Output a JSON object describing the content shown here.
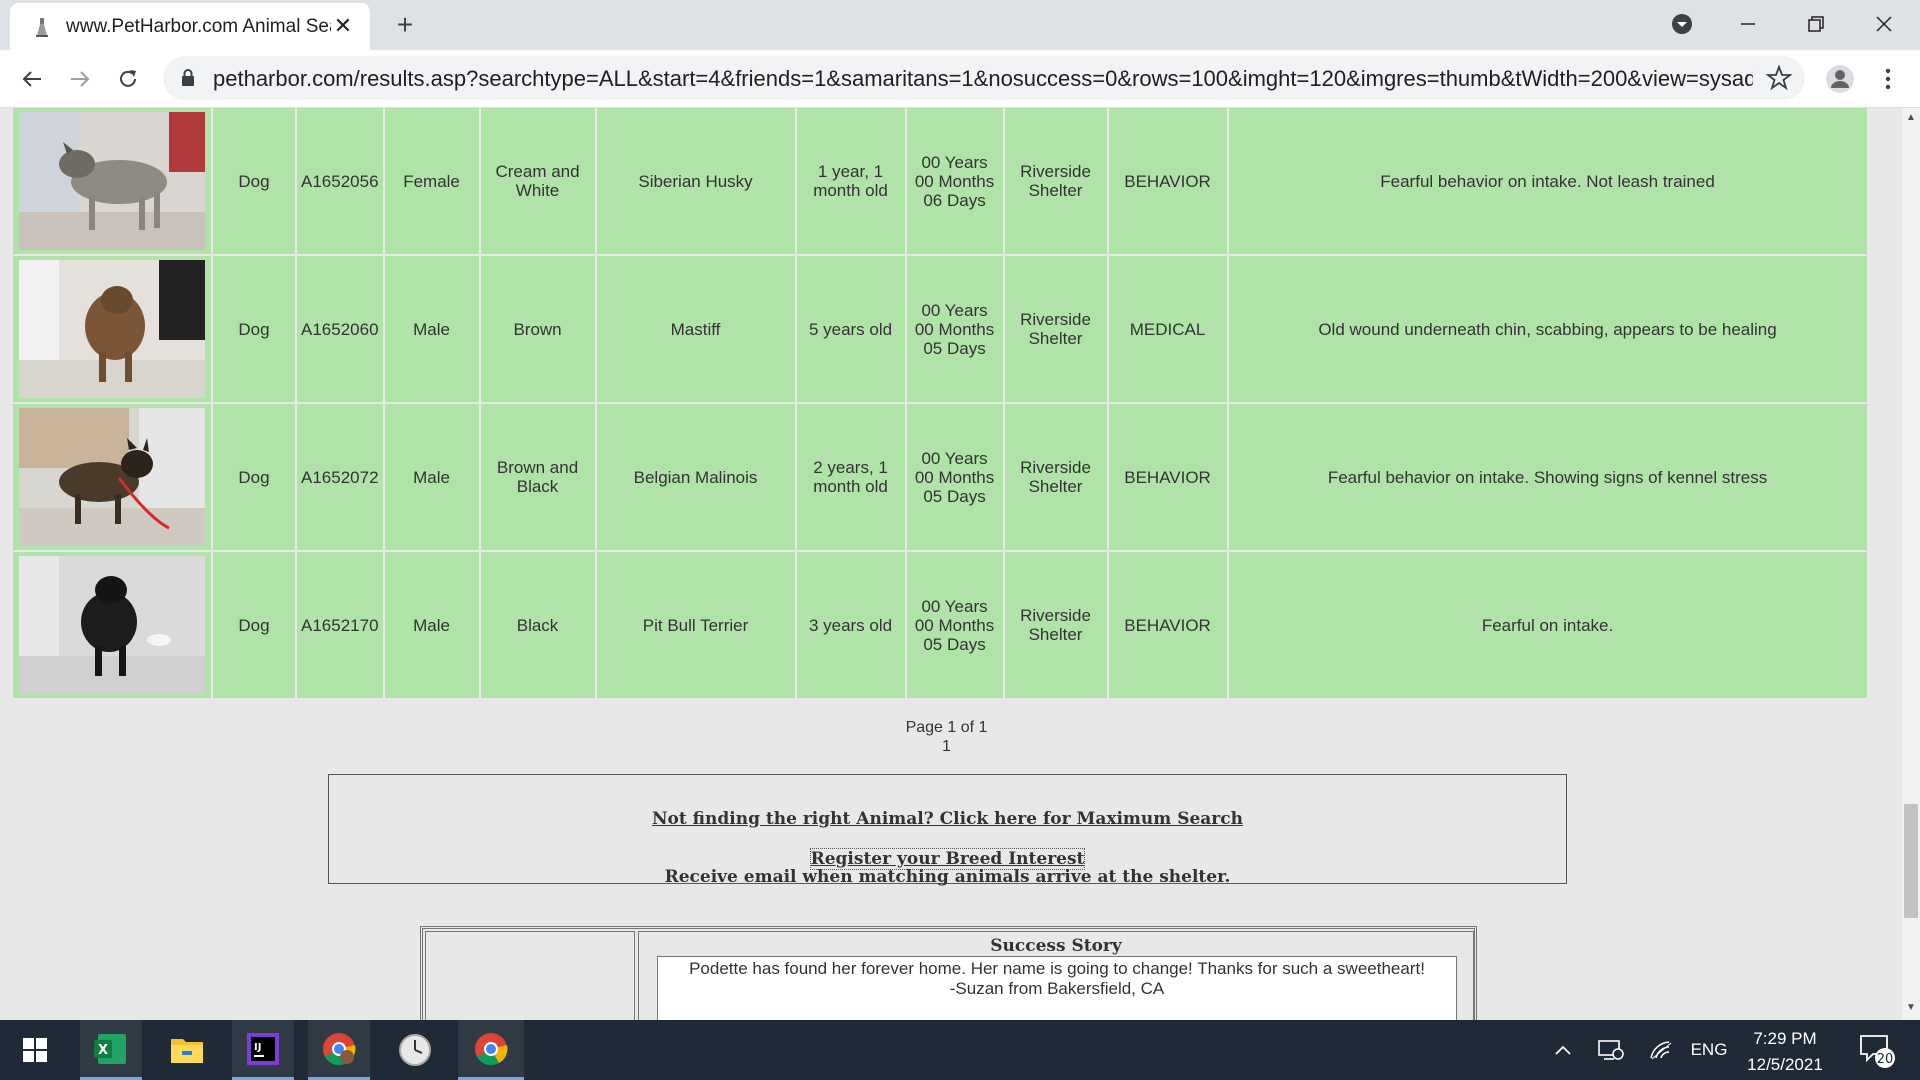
{
  "browser": {
    "tab_title": "www.PetHarbor.com Animal Sear",
    "url": "petharbor.com/results.asp?searchtype=ALL&start=4&friends=1&samaritans=1&nosuccess=0&rows=100&imght=120&imgres=thumb&tWidth=200&view=sysadm..."
  },
  "animals": [
    {
      "type": "Dog",
      "id": "A1652056",
      "gender": "Female",
      "color": "Cream and White",
      "breed": "Siberian Husky",
      "age": "1 year, 1 month old",
      "days_years": "00 Years",
      "days_months": "00 Months",
      "days_days": "06 Days",
      "shelter": "Riverside Shelter",
      "reason": "BEHAVIOR",
      "notes": "Fearful behavior on intake. Not leash trained",
      "photo_desc": "grey-husky-photo"
    },
    {
      "type": "Dog",
      "id": "A1652060",
      "gender": "Male",
      "color": "Brown",
      "breed": "Mastiff",
      "age": "5 years old",
      "days_years": "00 Years",
      "days_months": "00 Months",
      "days_days": "05 Days",
      "shelter": "Riverside Shelter",
      "reason": "MEDICAL",
      "notes": "Old wound underneath chin, scabbing, appears to be healing",
      "photo_desc": "brown-mastiff-photo"
    },
    {
      "type": "Dog",
      "id": "A1652072",
      "gender": "Male",
      "color": "Brown and Black",
      "breed": "Belgian Malinois",
      "age": "2 years, 1 month old",
      "days_years": "00 Years",
      "days_months": "00 Months",
      "days_days": "05 Days",
      "shelter": "Riverside Shelter",
      "reason": "BEHAVIOR",
      "notes": "Fearful behavior on intake. Showing signs of kennel stress",
      "photo_desc": "malinois-photo"
    },
    {
      "type": "Dog",
      "id": "A1652170",
      "gender": "Male",
      "color": "Black",
      "breed": "Pit Bull Terrier",
      "age": "3 years old",
      "days_years": "00 Years",
      "days_months": "00 Months",
      "days_days": "05 Days",
      "shelter": "Riverside Shelter",
      "reason": "BEHAVIOR",
      "notes": "Fearful on intake.",
      "photo_desc": "black-pitbull-photo"
    }
  ],
  "pager": {
    "text": "Page 1 of 1",
    "page_link": "1"
  },
  "links": {
    "max_search": "Not finding the right Animal? Click here for Maximum Search",
    "breed_interest": "Register your Breed Interest",
    "breed_interest_sub": "Receive email when matching animals arrive at the shelter."
  },
  "story": {
    "heading": "Success Story",
    "line1": "Podette has found her forever home.  Her name is going to change!  Thanks for such a sweetheart!",
    "line2": "-Suzan from Bakersfield, CA"
  },
  "taskbar": {
    "lang": "ENG",
    "time": "7:29 PM",
    "date": "12/5/2021",
    "notifications": "20"
  },
  "colors": {
    "row_bg": "#b0e3a8",
    "taskbar": "#1f2a36"
  }
}
